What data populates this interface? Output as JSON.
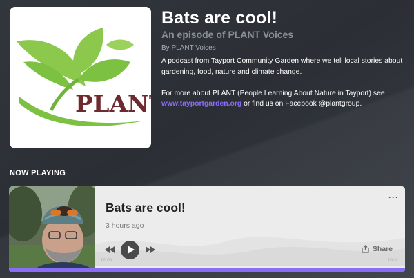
{
  "episode": {
    "title": "Bats are cool!",
    "subtitle": "An episode of PLANT Voices",
    "byline": "By PLANT Voices",
    "description_1": "A podcast from Tayport Community Garden where we tell local stories about gardening, food, nature and climate change.",
    "description_2_prefix": "For more about PLANT (People Learning About Nature in Tayport) see ",
    "description_2_link": "www.tayportgarden.org",
    "description_2_suffix": " or find us on Facebook @plantgroup.",
    "cover_logo_text": "PLANT"
  },
  "section": {
    "now_playing_label": "NOW PLAYING"
  },
  "player": {
    "title": "Bats are cool!",
    "posted": "3 hours ago",
    "more_label": "···",
    "share_label": "Share",
    "time_start": "00:00",
    "time_end": "10:32",
    "progress_fraction": 1.0
  },
  "colors": {
    "accent": "#8b6cf6",
    "background": "#2e3238",
    "logo_green": "#7cc142",
    "logo_text": "#6e2a2e"
  },
  "icons": {
    "rewind": "rewind-icon",
    "play": "play-icon",
    "fast_forward": "fast-forward-icon",
    "share": "share-icon",
    "more": "more-icon"
  }
}
